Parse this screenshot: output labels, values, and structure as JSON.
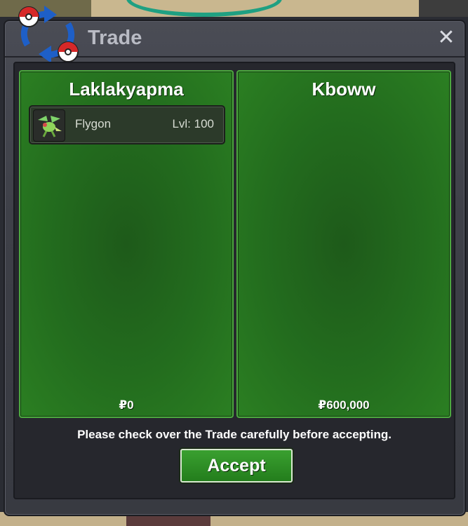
{
  "window": {
    "title": "Trade"
  },
  "left_panel": {
    "player": "Laklakyapma",
    "money": "₽0",
    "pokemon": [
      {
        "name": "Flygon",
        "level": "Lvl: 100"
      }
    ]
  },
  "right_panel": {
    "player": "Kboww",
    "money": "₽600,000"
  },
  "notice": "Please check over the Trade carefully before accepting.",
  "accept_label": "Accept",
  "colors": {
    "panel_green": "#236d1e",
    "accent": "#3aa030",
    "window": "#3e4048"
  }
}
